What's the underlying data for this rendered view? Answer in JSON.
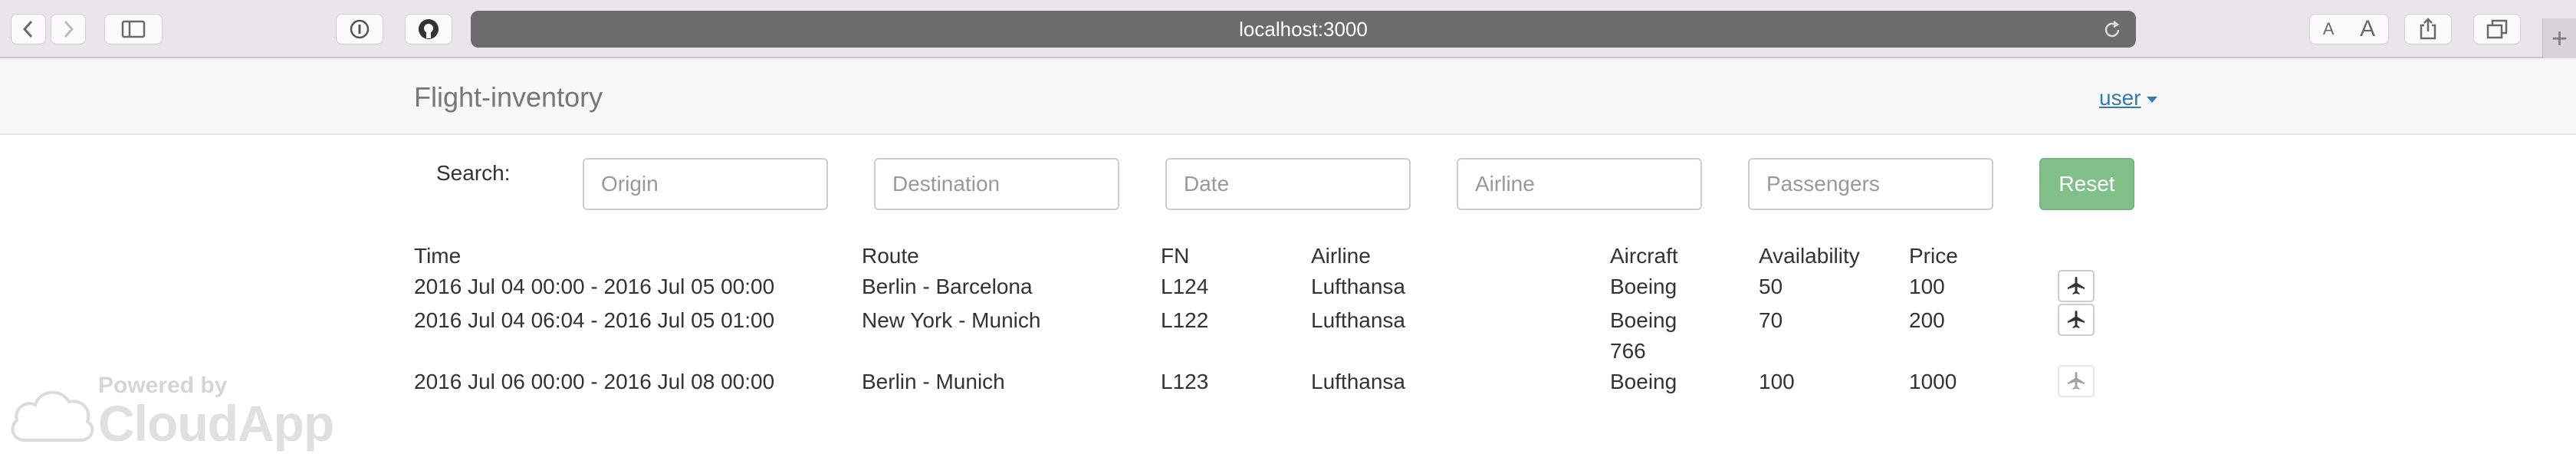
{
  "browser": {
    "url": "localhost:3000"
  },
  "navbar": {
    "brand": "Flight-inventory",
    "user_menu": "user"
  },
  "search": {
    "label": "Search:",
    "origin_placeholder": "Origin",
    "origin_value": "",
    "destination_placeholder": "Destination",
    "destination_value": "",
    "date_placeholder": "Date",
    "date_value": "",
    "airline_placeholder": "Airline",
    "airline_value": "",
    "passengers_placeholder": "Passengers",
    "passengers_value": "",
    "reset_label": "Reset"
  },
  "table": {
    "headers": {
      "time": "Time",
      "route": "Route",
      "fn": "FN",
      "airline": "Airline",
      "aircraft": "Aircraft",
      "availability": "Availability",
      "price": "Price"
    },
    "rows": [
      {
        "time": "2016 Jul 04 00:00 - 2016 Jul 05 00:00",
        "route": "Berlin - Barcelona",
        "fn": "L124",
        "airline": "Lufthansa",
        "aircraft": "Boeing",
        "aircraft_line2": "",
        "availability": "50",
        "price": "100",
        "book_icon": "airplane-icon",
        "book_enabled": true
      },
      {
        "time": "2016 Jul 04 06:04 - 2016 Jul 05 01:00",
        "route": "New York - Munich",
        "fn": "L122",
        "airline": "Lufthansa",
        "aircraft": "Boeing",
        "aircraft_line2": "766",
        "availability": "70",
        "price": "200",
        "book_icon": "airplane-icon",
        "book_enabled": true
      },
      {
        "time": "2016 Jul 06 00:00 - 2016 Jul 08 00:00",
        "route": "Berlin - Munich",
        "fn": "L123",
        "airline": "Lufthansa",
        "aircraft": "Boeing",
        "aircraft_line2": "",
        "availability": "100",
        "price": "1000",
        "book_icon": "airplane-icon",
        "book_enabled": false
      }
    ]
  },
  "watermark": {
    "line1": "Powered by",
    "line2": "CloudApp"
  },
  "colors": {
    "brand_text": "#777777",
    "link": "#337ab7",
    "reset_button": "#82c08a",
    "url_bar": "#6c6c6c"
  }
}
